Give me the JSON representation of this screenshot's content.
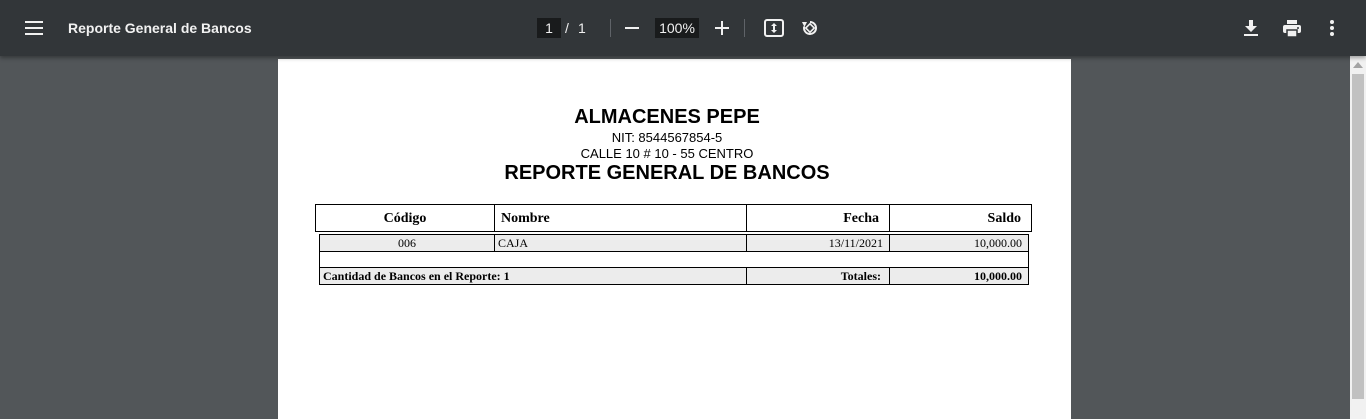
{
  "toolbar": {
    "title": "Reporte General de Bancos",
    "page_current": "1",
    "page_separator": "/",
    "page_total": "1",
    "zoom": "100%"
  },
  "report": {
    "company": "ALMACENES PEPE",
    "nit": "NIT: 8544567854-5",
    "address": "CALLE 10 # 10 - 55 CENTRO",
    "title": "REPORTE GENERAL DE BANCOS",
    "columns": {
      "codigo": "Código",
      "nombre": "Nombre",
      "fecha": "Fecha",
      "saldo": "Saldo"
    },
    "rows": [
      {
        "codigo": "006",
        "nombre": "CAJA",
        "fecha": "13/11/2021",
        "saldo": "10,000.00"
      }
    ],
    "footer": {
      "count_label": "Cantidad de Bancos en el Reporte: 1",
      "totals_label": "Totales:",
      "totals_value": "10,000.00"
    }
  },
  "colors": {
    "toolbar_bg": "#323639",
    "viewer_bg": "#525659",
    "page_bg": "#ffffff",
    "row_shade": "#ececec"
  },
  "icons": {
    "menu": "menu-icon",
    "zoom_out": "minus-icon",
    "zoom_in": "plus-icon",
    "fit": "fit-to-page-icon",
    "rotate": "rotate-icon",
    "download": "download-icon",
    "print": "print-icon",
    "more": "more-vert-icon"
  }
}
